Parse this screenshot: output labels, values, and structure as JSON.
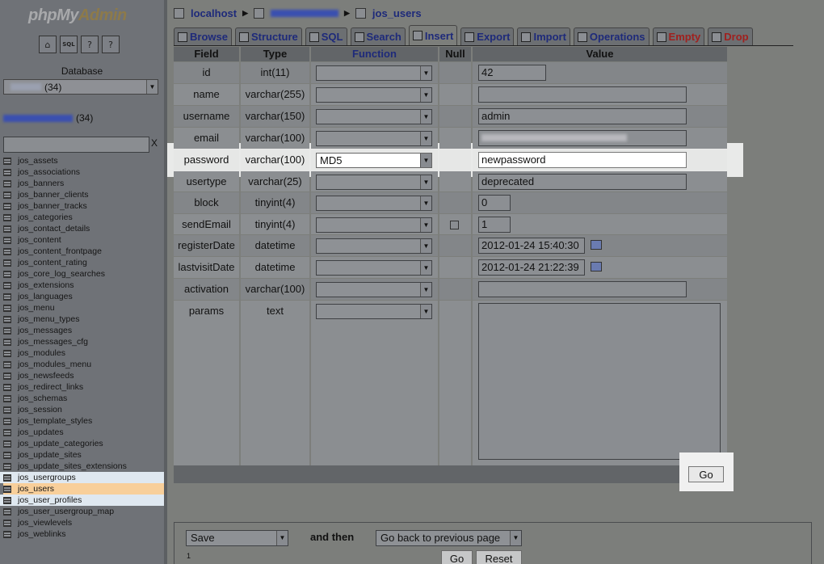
{
  "nav": {
    "logo_php": "php",
    "logo_my": "My",
    "logo_admin": "Admin",
    "icons": [
      "home-icon",
      "sql-query-icon",
      "docs-icon",
      "docs-alt-icon"
    ],
    "icon_glyphs": [
      "⌂",
      "SQL",
      "?",
      "?"
    ],
    "database_label": "Database",
    "db_select_count": "(34)",
    "db_count": "(34)",
    "filter_clear": "X",
    "tables": [
      "jos_assets",
      "jos_associations",
      "jos_banners",
      "jos_banner_clients",
      "jos_banner_tracks",
      "jos_categories",
      "jos_contact_details",
      "jos_content",
      "jos_content_frontpage",
      "jos_content_rating",
      "jos_core_log_searches",
      "jos_extensions",
      "jos_languages",
      "jos_menu",
      "jos_menu_types",
      "jos_messages",
      "jos_messages_cfg",
      "jos_modules",
      "jos_modules_menu",
      "jos_newsfeeds",
      "jos_redirect_links",
      "jos_schemas",
      "jos_session",
      "jos_template_styles",
      "jos_updates",
      "jos_update_categories",
      "jos_update_sites",
      "jos_update_sites_extensions",
      "jos_usergroups",
      "jos_users",
      "jos_user_profiles",
      "jos_user_usergroup_map",
      "jos_viewlevels",
      "jos_weblinks"
    ],
    "selected_table": "jos_users"
  },
  "breadcrumb": {
    "server": "localhost",
    "table": "jos_users"
  },
  "tabs": [
    "Browse",
    "Structure",
    "SQL",
    "Search",
    "Insert",
    "Export",
    "Import",
    "Operations",
    "Empty",
    "Drop"
  ],
  "grid": {
    "headers": {
      "field": "Field",
      "type": "Type",
      "function": "Function",
      "null": "Null",
      "value": "Value"
    },
    "rows": [
      {
        "field": "id",
        "type": "int(11)",
        "function": "",
        "value": "42"
      },
      {
        "field": "name",
        "type": "varchar(255)",
        "function": "",
        "value": ""
      },
      {
        "field": "username",
        "type": "varchar(150)",
        "function": "",
        "value": "admin"
      },
      {
        "field": "email",
        "type": "varchar(100)",
        "function": "",
        "value": ""
      },
      {
        "field": "password",
        "type": "varchar(100)",
        "function": "MD5",
        "value": "newpassword"
      },
      {
        "field": "usertype",
        "type": "varchar(25)",
        "function": "",
        "value": "deprecated"
      },
      {
        "field": "block",
        "type": "tinyint(4)",
        "function": "",
        "value": "0"
      },
      {
        "field": "sendEmail",
        "type": "tinyint(4)",
        "function": "",
        "value": "1"
      },
      {
        "field": "registerDate",
        "type": "datetime",
        "function": "",
        "value": "2012-01-24 15:40:30"
      },
      {
        "field": "lastvisitDate",
        "type": "datetime",
        "function": "",
        "value": "2012-01-24 21:22:39"
      },
      {
        "field": "activation",
        "type": "varchar(100)",
        "function": "",
        "value": ""
      },
      {
        "field": "params",
        "type": "text",
        "function": "",
        "value": ""
      }
    ],
    "go_label": "Go"
  },
  "bottom": {
    "after_action": "Save",
    "and_then": "and then",
    "goto": "Go back to previous page",
    "count": "1",
    "go_label": "Go",
    "reset_label": "Reset"
  }
}
